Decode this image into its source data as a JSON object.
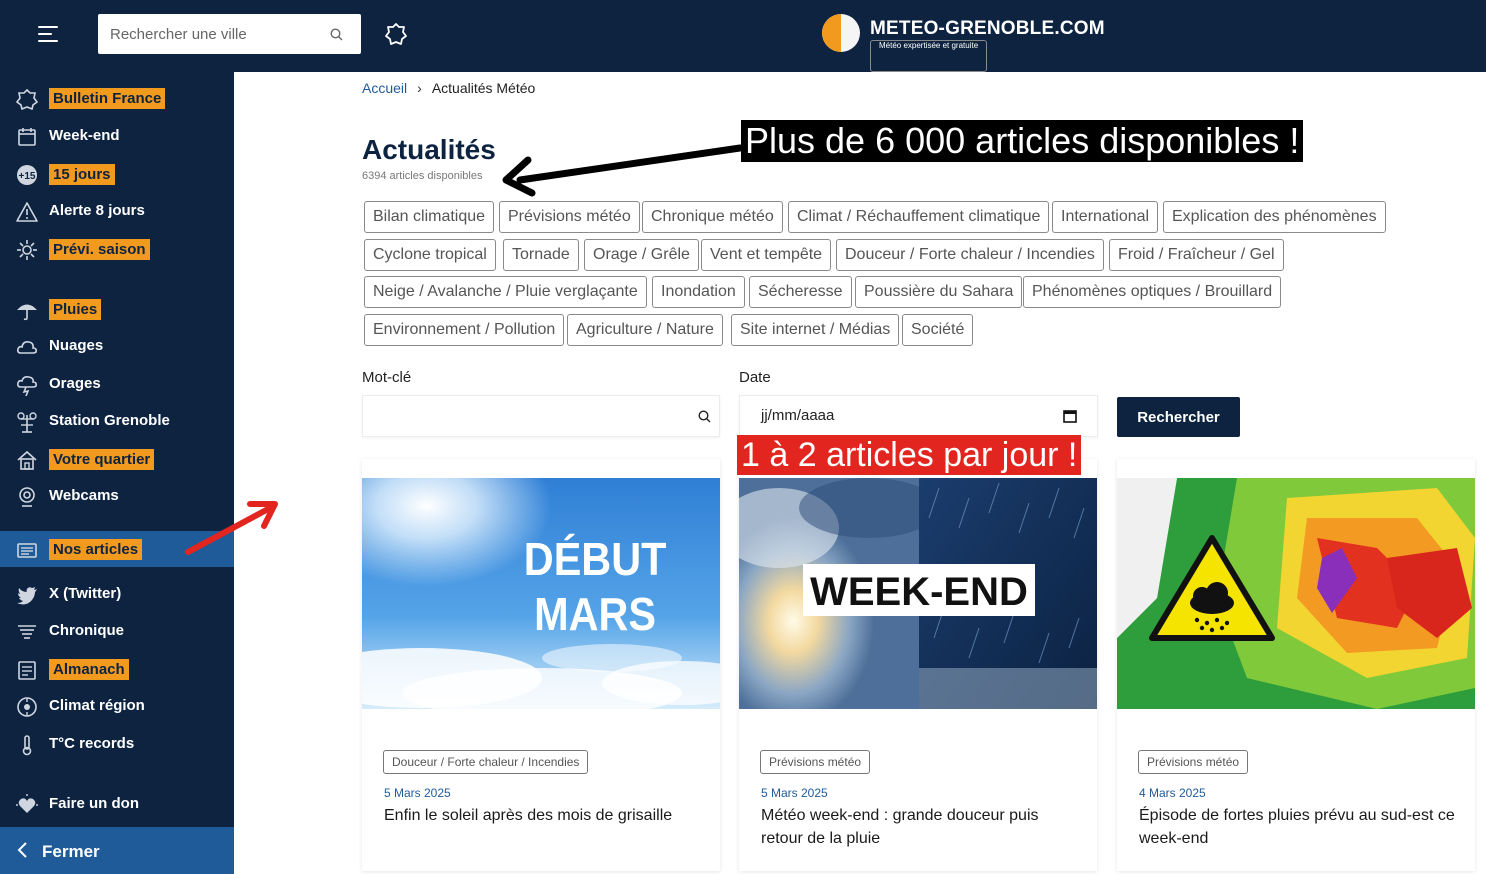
{
  "header": {
    "search_placeholder": "Rechercher une ville",
    "logo_name": "METEO-GRENOBLE.COM",
    "logo_tagline": "Météo expertisée et gratuite"
  },
  "sidebar": {
    "items": [
      {
        "label": "Bulletin France",
        "icon": "star-map-icon",
        "highlight": true
      },
      {
        "label": "Week-end",
        "icon": "calendar-icon",
        "highlight": false
      },
      {
        "label": "15 jours",
        "icon": "plus15-icon",
        "highlight": true
      },
      {
        "label": "Alerte 8 jours",
        "icon": "warning-icon",
        "highlight": false
      },
      {
        "label": "Prévi. saison",
        "icon": "sun-snow-icon",
        "highlight": true
      },
      {
        "label": "Pluies",
        "icon": "umbrella-icon",
        "highlight": true
      },
      {
        "label": "Nuages",
        "icon": "cloud-icon",
        "highlight": false
      },
      {
        "label": "Orages",
        "icon": "storm-icon",
        "highlight": false
      },
      {
        "label": "Station Grenoble",
        "icon": "station-icon",
        "highlight": false
      },
      {
        "label": "Votre quartier",
        "icon": "home-icon",
        "highlight": true
      },
      {
        "label": "Webcams",
        "icon": "webcam-icon",
        "highlight": false
      },
      {
        "label": "Nos articles",
        "icon": "articles-icon",
        "highlight": true,
        "active": true
      },
      {
        "label": "X (Twitter)",
        "icon": "twitter-icon",
        "highlight": false
      },
      {
        "label": "Chronique",
        "icon": "wind-icon",
        "highlight": false
      },
      {
        "label": "Almanach",
        "icon": "almanac-icon",
        "highlight": true
      },
      {
        "label": "Climat région",
        "icon": "climate-icon",
        "highlight": false
      },
      {
        "label": "T°C records",
        "icon": "thermometer-icon",
        "highlight": false
      },
      {
        "label": "Faire un don",
        "icon": "donate-icon",
        "highlight": false
      }
    ],
    "close_label": "Fermer"
  },
  "breadcrumb": {
    "home": "Accueil",
    "current": "Actualités Météo"
  },
  "page": {
    "title": "Actualités",
    "count": "6394 articles disponibles"
  },
  "annotations": {
    "banner_top": "Plus de 6 000 articles disponibles !",
    "banner_cards": "1 à 2 articles par jour !"
  },
  "tags": [
    "Bilan climatique",
    "Prévisions météo",
    "Chronique météo",
    "Climat / Réchauffement climatique",
    "International",
    "Explication des phénomènes",
    "Cyclone tropical",
    "Tornade",
    "Orage / Grêle",
    "Vent et tempête",
    "Douceur / Forte chaleur / Incendies",
    "Froid / Fraîcheur / Gel",
    "Neige / Avalanche / Pluie verglaçante",
    "Inondation",
    "Sécheresse",
    "Poussière du Sahara",
    "Phénomènes optiques / Brouillard",
    "Environnement / Pollution",
    "Agriculture / Nature",
    "Site internet / Médias",
    "Société"
  ],
  "filters": {
    "keyword_label": "Mot-clé",
    "keyword_value": "",
    "date_label": "Date",
    "date_placeholder": "jj/mm/aaaa",
    "submit_label": "Rechercher"
  },
  "cards": [
    {
      "tag": "Douceur / Forte chaleur / Incendies",
      "date": "5 Mars 2025",
      "title": "Enfin le soleil après des mois de grisaille",
      "image_text": [
        "DÉBUT",
        "MARS"
      ]
    },
    {
      "tag": "Prévisions météo",
      "date": "5 Mars 2025",
      "title": "Météo week-end : grande douceur puis retour de la pluie",
      "image_text": [
        "WEEK-END"
      ]
    },
    {
      "tag": "Prévisions météo",
      "date": "4 Mars 2025",
      "title": "Épisode de fortes pluies prévu au sud-est ce week-end",
      "image_text": []
    }
  ],
  "colors": {
    "navy": "#0d2340",
    "accent": "#f29a1e",
    "active": "#1f5a99",
    "annotation_red": "#e32520"
  }
}
